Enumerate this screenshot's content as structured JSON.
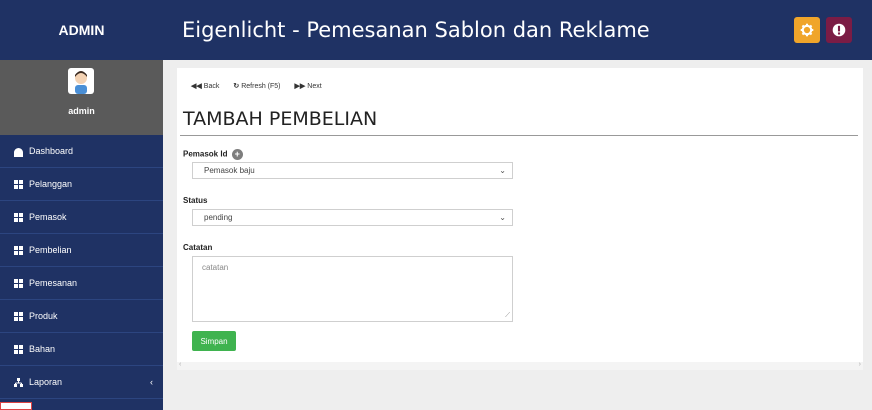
{
  "app": {
    "brand": "ADMIN",
    "title": "Eigenlicht - Pemesanan Sablon dan Reklame"
  },
  "profile": {
    "name": "admin"
  },
  "sidebar": {
    "items": [
      {
        "label": "Dashboard",
        "icon": "dashboard-icon"
      },
      {
        "label": "Pelanggan",
        "icon": "grid-icon"
      },
      {
        "label": "Pemasok",
        "icon": "grid-icon"
      },
      {
        "label": "Pembelian",
        "icon": "grid-icon"
      },
      {
        "label": "Pemesanan",
        "icon": "grid-icon"
      },
      {
        "label": "Produk",
        "icon": "grid-icon"
      },
      {
        "label": "Bahan",
        "icon": "grid-icon"
      },
      {
        "label": "Laporan",
        "icon": "sitemap-icon"
      }
    ]
  },
  "toolbar": {
    "back": "Back",
    "refresh": "Refresh (F5)",
    "next": "Next"
  },
  "page": {
    "title": "TAMBAH PEMBELIAN"
  },
  "form": {
    "pemasok_label": "Pemasok Id",
    "pemasok_value": "Pemasok baju",
    "status_label": "Status",
    "status_value": "pending",
    "catatan_label": "Catatan",
    "catatan_placeholder": "catatan",
    "save_label": "Simpan"
  },
  "colors": {
    "navbar": "#1f3264",
    "gear_button": "#f0a52a",
    "alert_button": "#7b1c45",
    "save_button": "#3fb34f"
  }
}
